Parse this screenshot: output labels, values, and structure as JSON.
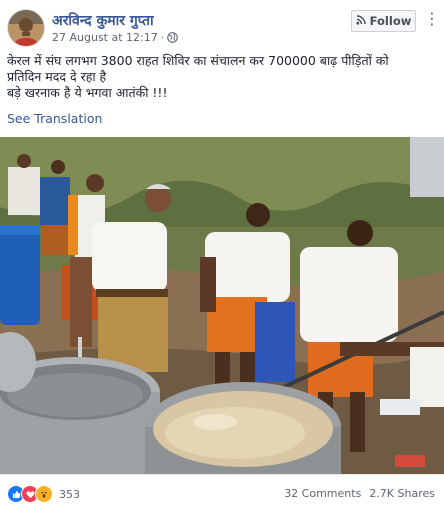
{
  "post": {
    "author": "अरविन्द कुमार गुप्ता",
    "date": "27 August at 12:17",
    "separator": "·",
    "follow_label": "Follow",
    "more_label": "⋮",
    "text_lines": [
      "केरल में संघ लगभग 3800 राहत शिविर का संचालन कर 700000 बाढ़ पीड़ितों को",
      "प्रतिदिन मदद दे रहा है",
      "बड़े खरनाक है ये भगवा आतंकी !!!"
    ],
    "see_translation": "See Translation",
    "reaction_count": "353",
    "comments": "32 Comments",
    "shares": "2.7K Shares"
  },
  "icons": {
    "privacy": "globe-icon",
    "follow": "rss-icon",
    "reactions": [
      "like-reaction-icon",
      "love-reaction-icon",
      "wow-reaction-icon"
    ]
  },
  "colors": {
    "link": "#385898",
    "meta": "#606770",
    "text": "#1d2129",
    "like": "#1877f2",
    "love": "#f33e58",
    "wow": "#f7b125"
  }
}
